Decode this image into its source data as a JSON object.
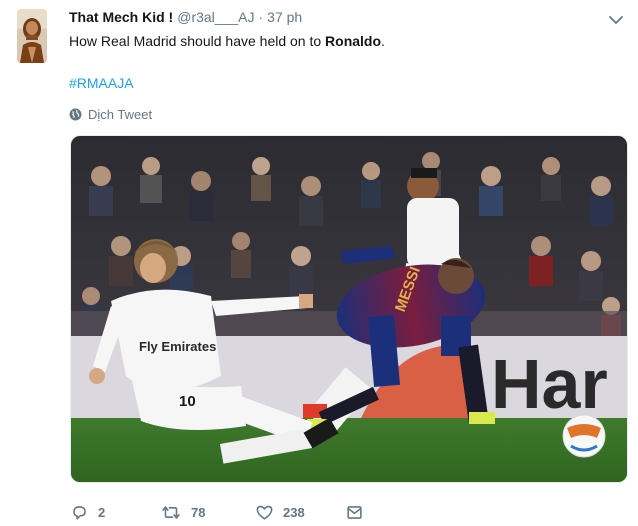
{
  "tweet": {
    "author": {
      "display_name": "That Mech Kid !",
      "handle": "@r3al___AJ",
      "avatar": "avatar-image"
    },
    "separator": "·",
    "timestamp": "37 ph",
    "text_prefix": "How Real Madrid should have held on to ",
    "text_bold": "Ronaldo",
    "text_suffix": ".",
    "hashtag": "#RMAAJA",
    "translate_label": "Dịch Tweet",
    "media": {
      "type": "photo",
      "jersey_name": "MESSI",
      "jersey_number": "10",
      "sponsor": "Fly Emirates",
      "board_text": "Har"
    },
    "actions": {
      "reply_count": "2",
      "retweet_count": "78",
      "like_count": "238"
    },
    "icons": {
      "menu": "chevron-down-icon",
      "translate": "globe-icon",
      "reply": "reply-icon",
      "retweet": "retweet-icon",
      "like": "heart-icon",
      "message": "envelope-icon"
    },
    "colors": {
      "link": "#1da1f2",
      "secondary_text": "#657786",
      "primary_text": "#14171a"
    }
  }
}
